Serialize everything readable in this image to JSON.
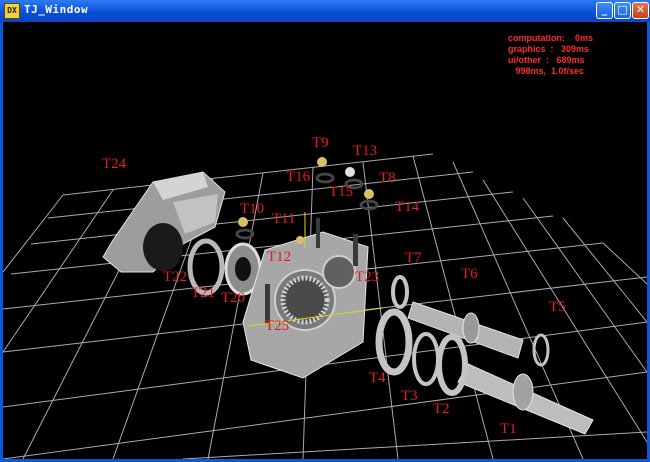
{
  "window": {
    "title": "TJ_Window",
    "icon": "app-icon",
    "buttons": {
      "minimize": "_",
      "maximize": "□",
      "close": "✕"
    }
  },
  "stats": {
    "computation": "computation:    0ms",
    "graphics": "graphics  :   309ms",
    "ui_other": "ui/other  :   689ms",
    "total": "   998ms,  1.0f/sec"
  },
  "labels": {
    "T1": "T1",
    "T2": "T2",
    "T3": "T3",
    "T4": "T4",
    "T5": "T5",
    "T6": "T6",
    "T7": "T7",
    "T8": "T8",
    "T9": "T9",
    "T10": "T10",
    "T11": "T11",
    "T12": "T12",
    "T13": "T13",
    "T14": "T14",
    "T15": "T15",
    "T16": "T16",
    "T20": "T20",
    "T21": "T21",
    "T22": "T22",
    "T23": "T23",
    "T24": "T24",
    "T25": "T25"
  },
  "colors": {
    "background": "#000000",
    "grid": "#cfcfcf",
    "label": "#e51d1d",
    "stats": "#ff2a2a",
    "part": "#bdbdbd"
  }
}
